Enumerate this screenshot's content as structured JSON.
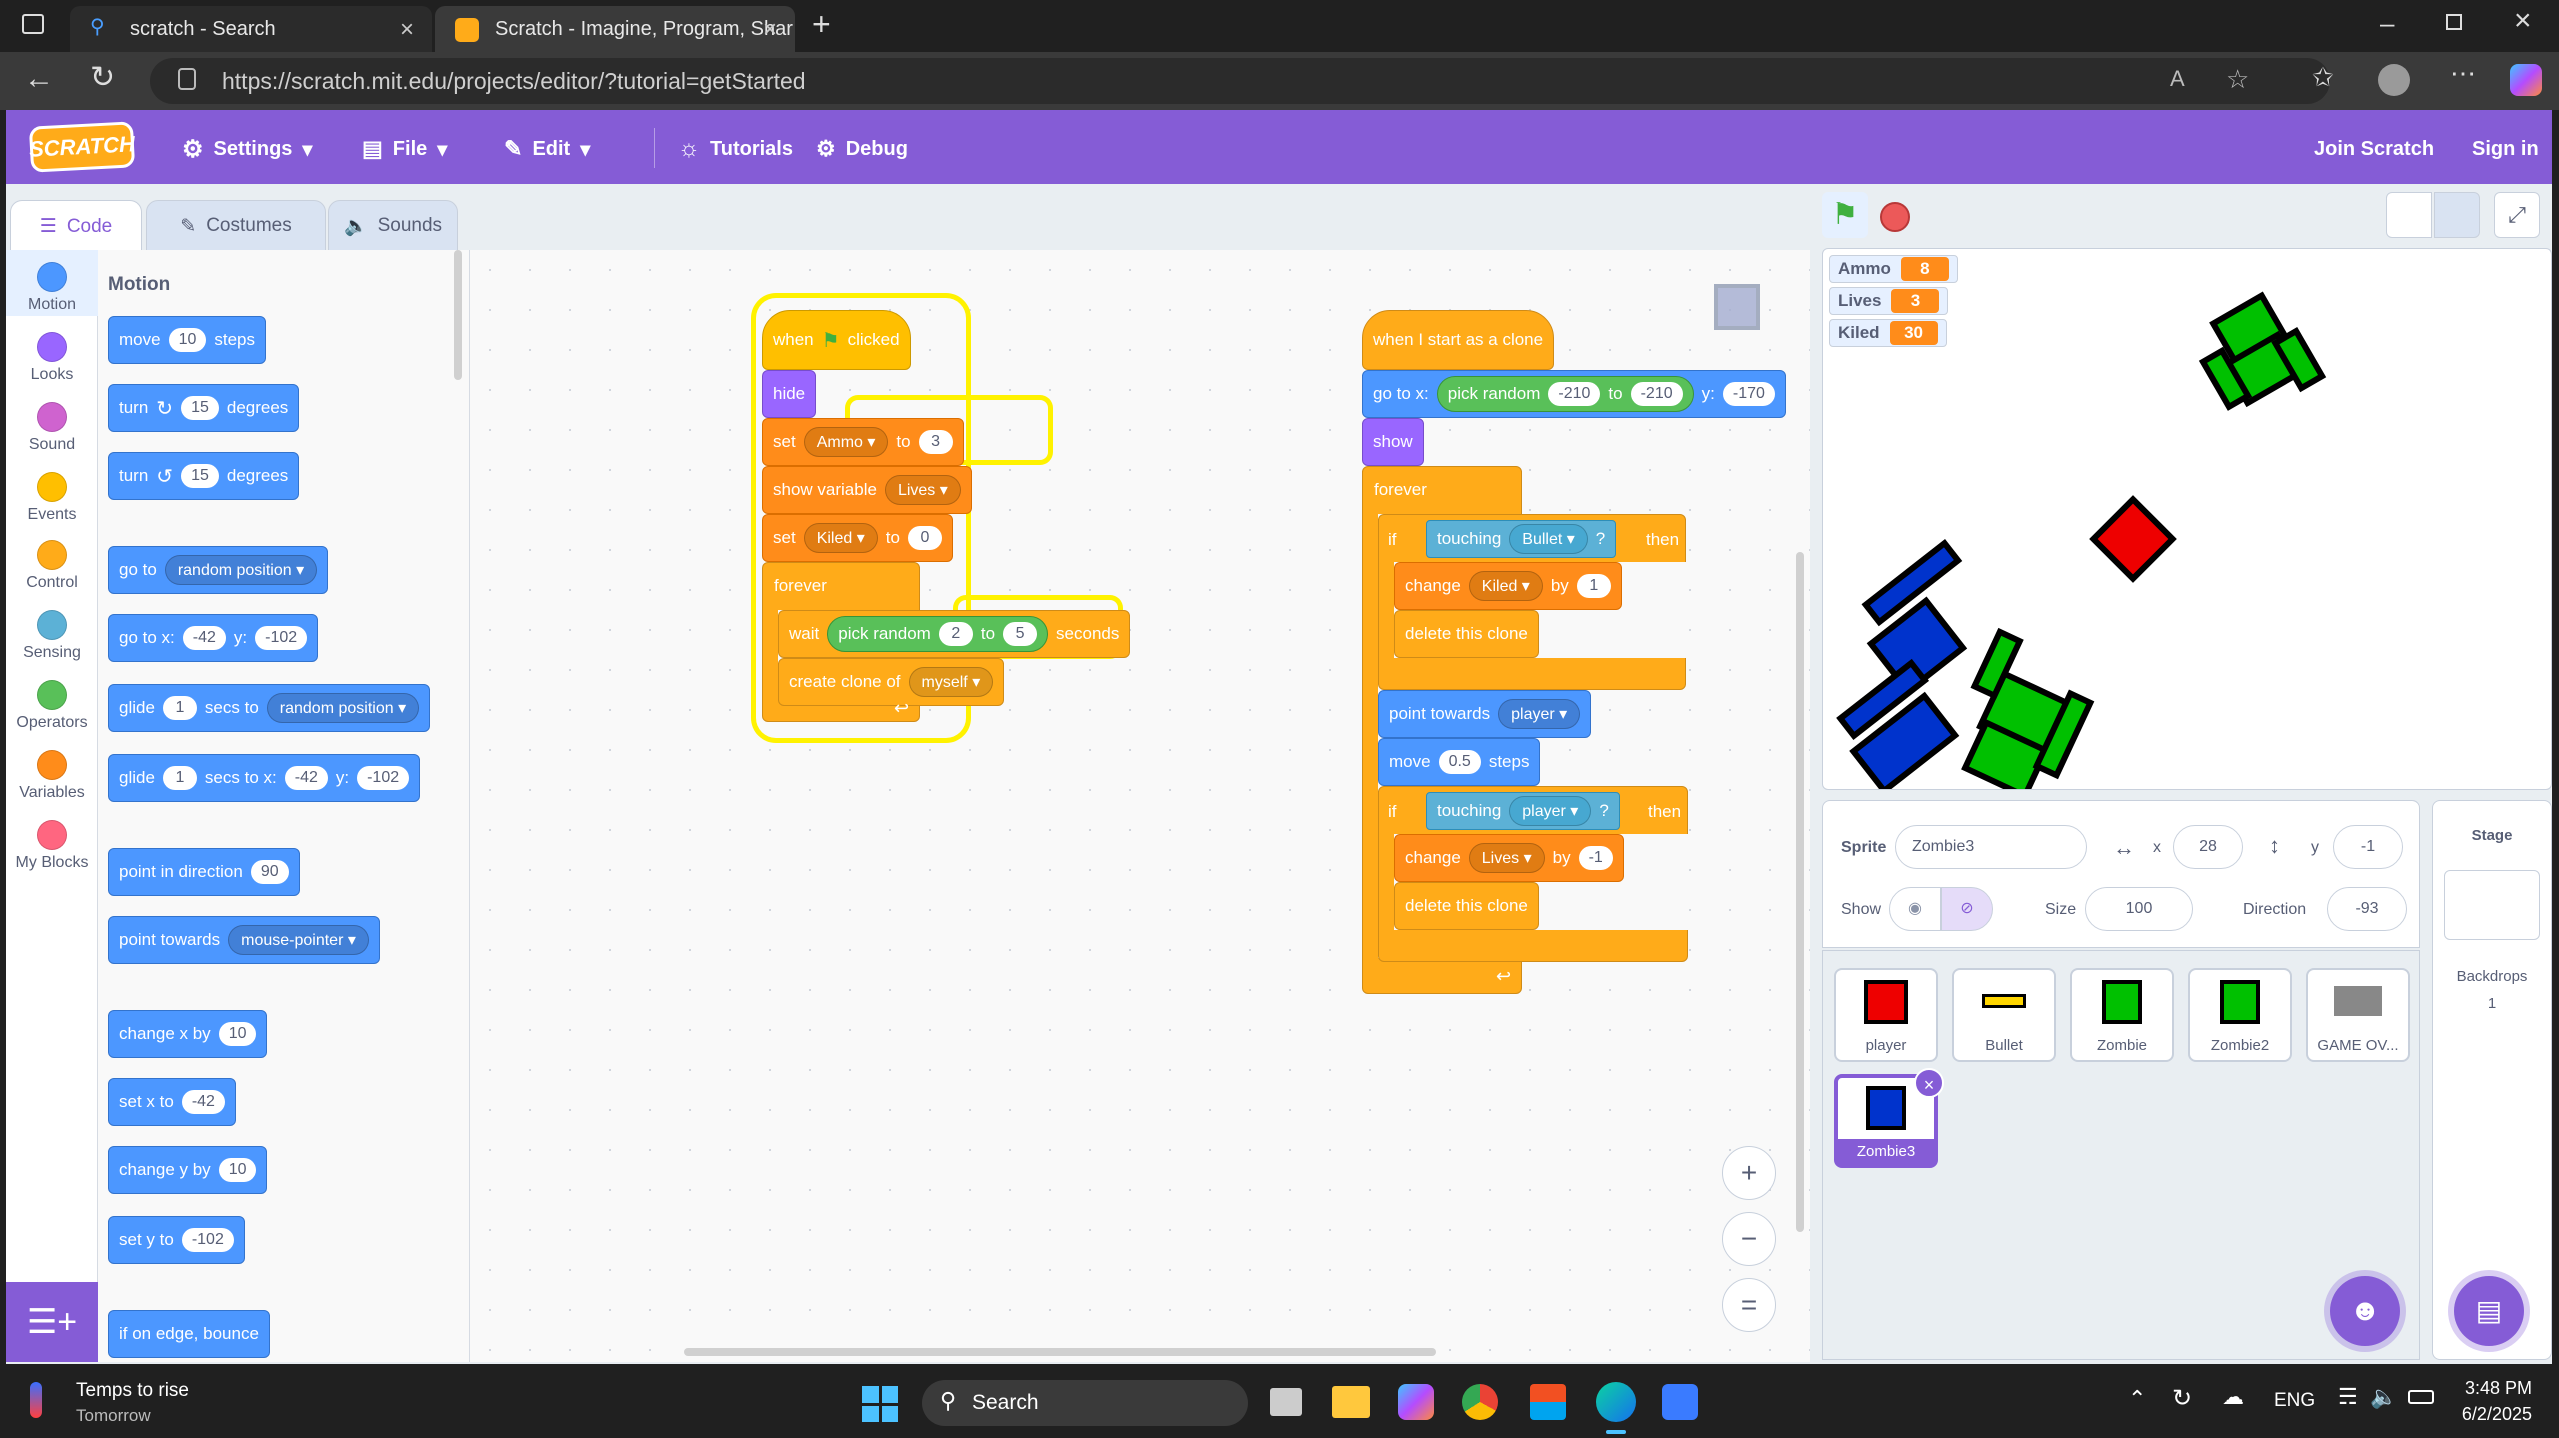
{
  "browser": {
    "tabs": [
      {
        "label": "scratch - Search"
      },
      {
        "label": "Scratch - Imagine, Program, Shar"
      }
    ],
    "url": "https://scratch.mit.edu/projects/editor/?tutorial=getStarted"
  },
  "menubar": {
    "logo": "SCRATCH",
    "settings": "Settings",
    "file": "File",
    "edit": "Edit",
    "tutorials": "Tutorials",
    "debug": "Debug",
    "join": "Join Scratch",
    "signin": "Sign in"
  },
  "editor_tabs": {
    "code": "Code",
    "costumes": "Costumes",
    "sounds": "Sounds"
  },
  "categories": [
    {
      "label": "Motion",
      "color": "#4c97ff"
    },
    {
      "label": "Looks",
      "color": "#9966ff"
    },
    {
      "label": "Sound",
      "color": "#cf63cf"
    },
    {
      "label": "Events",
      "color": "#ffbf00"
    },
    {
      "label": "Control",
      "color": "#ffab19"
    },
    {
      "label": "Sensing",
      "color": "#5cb1d6"
    },
    {
      "label": "Operators",
      "color": "#59c059"
    },
    {
      "label": "Variables",
      "color": "#ff8c1a"
    },
    {
      "label": "My Blocks",
      "color": "#ff6680"
    }
  ],
  "palette": {
    "title": "Motion",
    "move": {
      "a": "move",
      "n": "10",
      "b": "steps"
    },
    "turn_cw": {
      "a": "turn",
      "n": "15",
      "b": "degrees"
    },
    "turn_ccw": {
      "a": "turn",
      "n": "15",
      "b": "degrees"
    },
    "goto": {
      "a": "go to",
      "dd": "random position"
    },
    "gotoxy": {
      "a": "go to x:",
      "x": "-42",
      "y_label": "y:",
      "y": "-102"
    },
    "glide1": {
      "a": "glide",
      "n": "1",
      "b": "secs to",
      "dd": "random position"
    },
    "glide2": {
      "a": "glide",
      "n": "1",
      "b": "secs to x:",
      "x": "-42",
      "y_label": "y:",
      "y": "-102"
    },
    "point_dir": {
      "a": "point in direction",
      "n": "90"
    },
    "point_towards": {
      "a": "point towards",
      "dd": "mouse-pointer"
    },
    "change_x": {
      "a": "change x by",
      "n": "10"
    },
    "set_x": {
      "a": "set x to",
      "n": "-42"
    },
    "change_y": {
      "a": "change y by",
      "n": "10"
    },
    "set_y": {
      "a": "set y to",
      "n": "-102"
    },
    "bounce": "if on edge, bounce"
  },
  "script1": {
    "when": "when",
    "clicked": "clicked",
    "hide": "hide",
    "set1": {
      "a": "set",
      "var": "Ammo",
      "to": "to",
      "val": "3"
    },
    "showvar": {
      "a": "show variable",
      "var": "Lives"
    },
    "set2": {
      "a": "set",
      "var": "Kiled",
      "to": "to",
      "val": "0"
    },
    "forever": "forever",
    "wait": {
      "a": "wait",
      "pick": "pick random",
      "from": "2",
      "to": "to",
      "upto": "5",
      "b": "seconds"
    },
    "clone": {
      "a": "create clone of",
      "dd": "myself"
    }
  },
  "script2": {
    "hat": "when I start as a clone",
    "goto": {
      "a": "go to x:",
      "pick": "pick random",
      "from": "-210",
      "to": "to",
      "upto": "-210",
      "y_label": "y:",
      "y": "-170"
    },
    "show": "show",
    "forever": "forever",
    "if1": {
      "if": "if",
      "touching": "touching",
      "dd": "Bullet",
      "q": "?",
      "then": "then"
    },
    "change1": {
      "a": "change",
      "var": "Kiled",
      "by": "by",
      "val": "1"
    },
    "delete1": "delete this clone",
    "point": {
      "a": "point towards",
      "dd": "player"
    },
    "move": {
      "a": "move",
      "n": "0.5",
      "b": "steps"
    },
    "if2": {
      "if": "if",
      "touching": "touching",
      "dd": "player",
      "q": "?",
      "then": "then"
    },
    "change2": {
      "a": "change",
      "var": "Lives",
      "by": "by",
      "val": "-1"
    },
    "delete2": "delete this clone"
  },
  "monitors": [
    {
      "name": "Ammo",
      "value": "8"
    },
    {
      "name": "Lives",
      "value": "3"
    },
    {
      "name": "Kiled",
      "value": "30"
    }
  ],
  "sprite_info": {
    "sprite_label": "Sprite",
    "sprite_name": "Zombie3",
    "x_label": "x",
    "x": "28",
    "y_label": "y",
    "y": "-1",
    "show_label": "Show",
    "size_label": "Size",
    "size": "100",
    "direction_label": "Direction",
    "direction": "-93"
  },
  "sprites": [
    {
      "name": "player"
    },
    {
      "name": "Bullet"
    },
    {
      "name": "Zombie"
    },
    {
      "name": "Zombie2"
    },
    {
      "name": "GAME OV..."
    },
    {
      "name": "Zombie3"
    }
  ],
  "stage_pane": {
    "title": "Stage",
    "backdrops_label": "Backdrops",
    "backdrops": "1"
  },
  "taskbar": {
    "weather_title": "Temps to rise",
    "weather_sub": "Tomorrow",
    "search": "Search",
    "lang": "ENG",
    "time": "3:48 PM",
    "date": "6/2/2025"
  }
}
